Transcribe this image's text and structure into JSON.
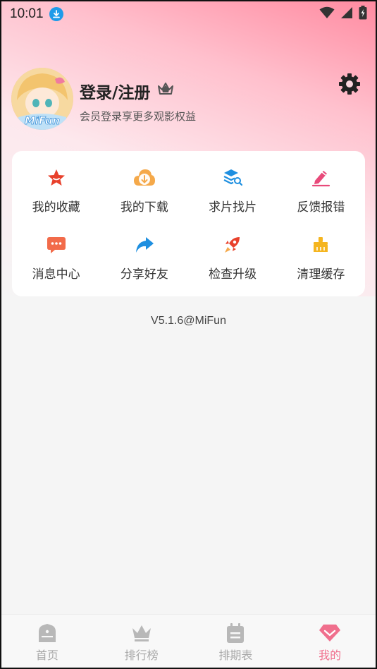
{
  "status_bar": {
    "time": "10:01",
    "icons": [
      "download-icon",
      "wifi-icon",
      "signal-icon",
      "battery-charging-icon"
    ]
  },
  "profile": {
    "avatar_text": "MiFun",
    "title": "登录/注册",
    "subtitle": "会员登录享更多观影权益",
    "crown_icon": "crown-icon",
    "settings_icon": "gear-icon"
  },
  "menu": [
    {
      "label": "我的收藏",
      "icon": "star-icon",
      "color": "#e8412c"
    },
    {
      "label": "我的下载",
      "icon": "cloud-download-icon",
      "color": "#f5a94a"
    },
    {
      "label": "求片找片",
      "icon": "layers-search-icon",
      "color": "#1e8fe0"
    },
    {
      "label": "反馈报错",
      "icon": "pencil-icon",
      "color": "#e84a7a"
    },
    {
      "label": "消息中心",
      "icon": "chat-icon",
      "color": "#f26b4a"
    },
    {
      "label": "分享好友",
      "icon": "share-icon",
      "color": "#1e8fe0"
    },
    {
      "label": "检查升级",
      "icon": "rocket-icon",
      "color": "#e8412c"
    },
    {
      "label": "清理缓存",
      "icon": "broom-icon",
      "color": "#f5b51f"
    }
  ],
  "version": "V5.1.6@MiFun",
  "bottom_nav": [
    {
      "label": "首页",
      "icon": "home-icon",
      "active": false
    },
    {
      "label": "排行榜",
      "icon": "crown-icon",
      "active": false
    },
    {
      "label": "排期表",
      "icon": "calendar-icon",
      "active": false
    },
    {
      "label": "我的",
      "icon": "heart-gem-icon",
      "active": true
    }
  ],
  "colors": {
    "accent": "#f06f8d",
    "inactive": "#b8b8b8",
    "header_pink": "#ff8aa0"
  }
}
